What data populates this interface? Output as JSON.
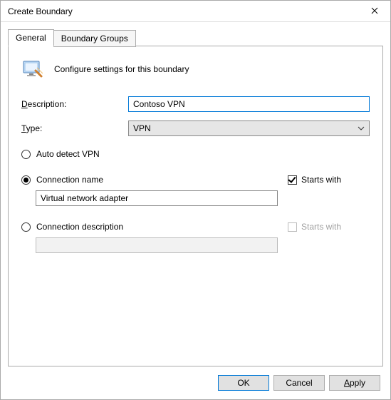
{
  "window": {
    "title": "Create Boundary"
  },
  "tabs": {
    "general": "General",
    "boundary_groups": "Boundary Groups"
  },
  "header": {
    "text": "Configure settings for this boundary"
  },
  "form": {
    "description_label_pre": "",
    "description_label_ul": "D",
    "description_label_post": "escription:",
    "description_value": "Contoso VPN",
    "type_label_pre": "",
    "type_label_ul": "T",
    "type_label_post": "ype:",
    "type_value": "VPN"
  },
  "vpn": {
    "auto_detect_label": "Auto detect VPN",
    "connection_name_label": "Connection name",
    "connection_description_label": "Connection description",
    "starts_with_label": "Starts with",
    "connection_name_value": "Virtual network adapter",
    "connection_description_value": ""
  },
  "buttons": {
    "ok": "OK",
    "cancel": "Cancel",
    "apply_ul": "A",
    "apply_post": "pply"
  }
}
